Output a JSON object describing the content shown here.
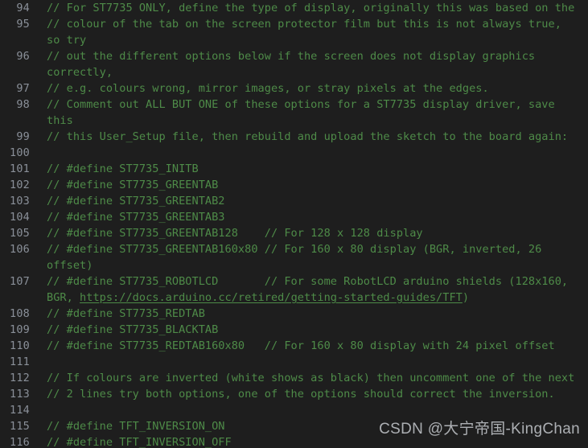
{
  "editor": {
    "background_color": "#1e1e1e",
    "gutter_color": "#8a9099",
    "comment_color": "#4e8b48",
    "link_color": "#4e8b48",
    "file_hint": "User_Setup",
    "language": "c"
  },
  "watermark": {
    "text": "CSDN @大宁帝国-KingChan"
  },
  "lines": [
    {
      "number": "94",
      "text": "// For ST7735 ONLY, define the type of display, originally this was based on the"
    },
    {
      "number": "95",
      "text": "// colour of the tab on the screen protector film but this is not always true,"
    },
    {
      "number": "",
      "text": "so try"
    },
    {
      "number": "96",
      "text": "// out the different options below if the screen does not display graphics"
    },
    {
      "number": "",
      "text": "correctly,"
    },
    {
      "number": "97",
      "text": "// e.g. colours wrong, mirror images, or stray pixels at the edges."
    },
    {
      "number": "98",
      "text": "// Comment out ALL BUT ONE of these options for a ST7735 display driver, save"
    },
    {
      "number": "",
      "text": "this"
    },
    {
      "number": "99",
      "text": "// this User_Setup file, then rebuild and upload the sketch to the board again:"
    },
    {
      "number": "100",
      "text": ""
    },
    {
      "number": "101",
      "text": "// #define ST7735_INITB"
    },
    {
      "number": "102",
      "text": "// #define ST7735_GREENTAB"
    },
    {
      "number": "103",
      "text": "// #define ST7735_GREENTAB2"
    },
    {
      "number": "104",
      "text": "// #define ST7735_GREENTAB3"
    },
    {
      "number": "105",
      "text": "// #define ST7735_GREENTAB128    // For 128 x 128 display"
    },
    {
      "number": "106",
      "text": "// #define ST7735_GREENTAB160x80 // For 160 x 80 display (BGR, inverted, 26"
    },
    {
      "number": "",
      "text": "offset)"
    },
    {
      "number": "107",
      "text": "// #define ST7735_ROBOTLCD       // For some RobotLCD arduino shields (128x160,"
    },
    {
      "number": "",
      "text": "BGR, ",
      "link": "https://docs.arduino.cc/retired/getting-started-guides/TFT",
      "text_after": ")"
    },
    {
      "number": "108",
      "text": "// #define ST7735_REDTAB"
    },
    {
      "number": "109",
      "text": "// #define ST7735_BLACKTAB"
    },
    {
      "number": "110",
      "text": "// #define ST7735_REDTAB160x80   // For 160 x 80 display with 24 pixel offset"
    },
    {
      "number": "111",
      "text": ""
    },
    {
      "number": "112",
      "text": "// If colours are inverted (white shows as black) then uncomment one of the next"
    },
    {
      "number": "113",
      "text": "// 2 lines try both options, one of the options should correct the inversion."
    },
    {
      "number": "114",
      "text": ""
    },
    {
      "number": "115",
      "text": "// #define TFT_INVERSION_ON"
    },
    {
      "number": "116",
      "text": "// #define TFT_INVERSION_OFF"
    }
  ]
}
